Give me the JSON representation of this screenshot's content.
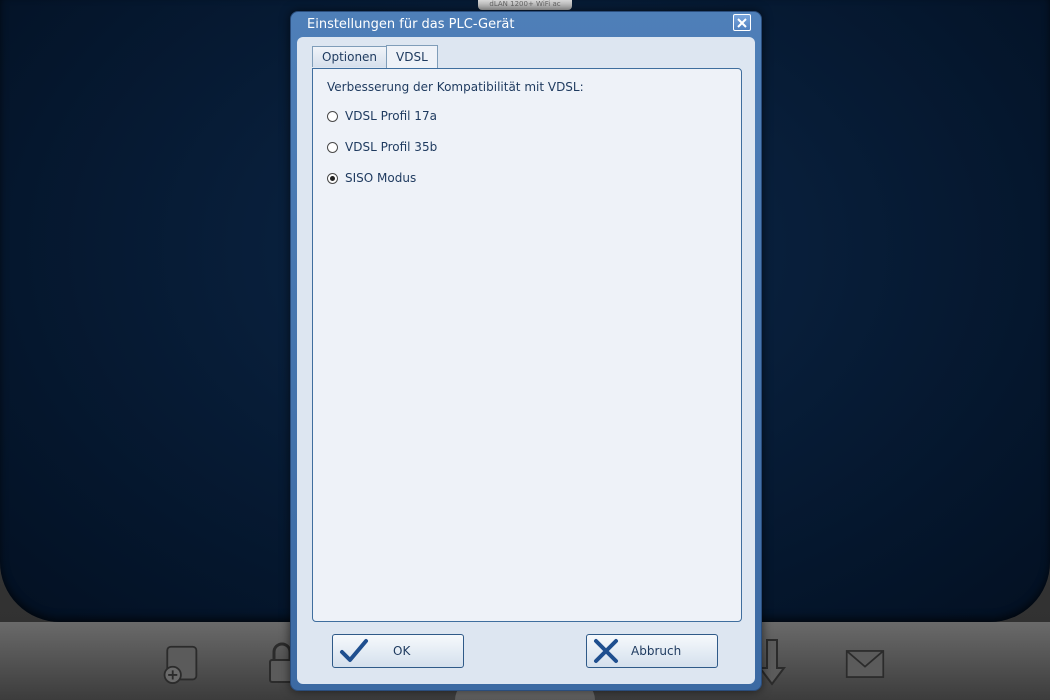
{
  "background_app": {
    "device_tab_label": "dLAN 1200+ WiFi ac",
    "toolbar_icons": [
      "add-device-icon",
      "lock-icon",
      "download-icon",
      "mail-icon"
    ]
  },
  "dialog": {
    "title": "Einstellungen für das PLC-Gerät",
    "close_icon": "close-icon",
    "tabs": [
      {
        "label": "Optionen",
        "active": false
      },
      {
        "label": "VDSL",
        "active": true
      }
    ],
    "vdsl": {
      "section_label": "Verbesserung der Kompatibilität mit VDSL:",
      "options": [
        {
          "label": "VDSL Profil 17a",
          "checked": false
        },
        {
          "label": "VDSL Profil 35b",
          "checked": false
        },
        {
          "label": "SISO Modus",
          "checked": true
        }
      ]
    },
    "buttons": {
      "ok_label": "OK",
      "cancel_label": "Abbruch"
    }
  },
  "colors": {
    "dialog_frame": "#4e7fb8",
    "dialog_body": "#dde6f1",
    "text": "#1e3a5f",
    "check_icon": "#1f4f8f",
    "cancel_icon": "#1f4f8f"
  }
}
